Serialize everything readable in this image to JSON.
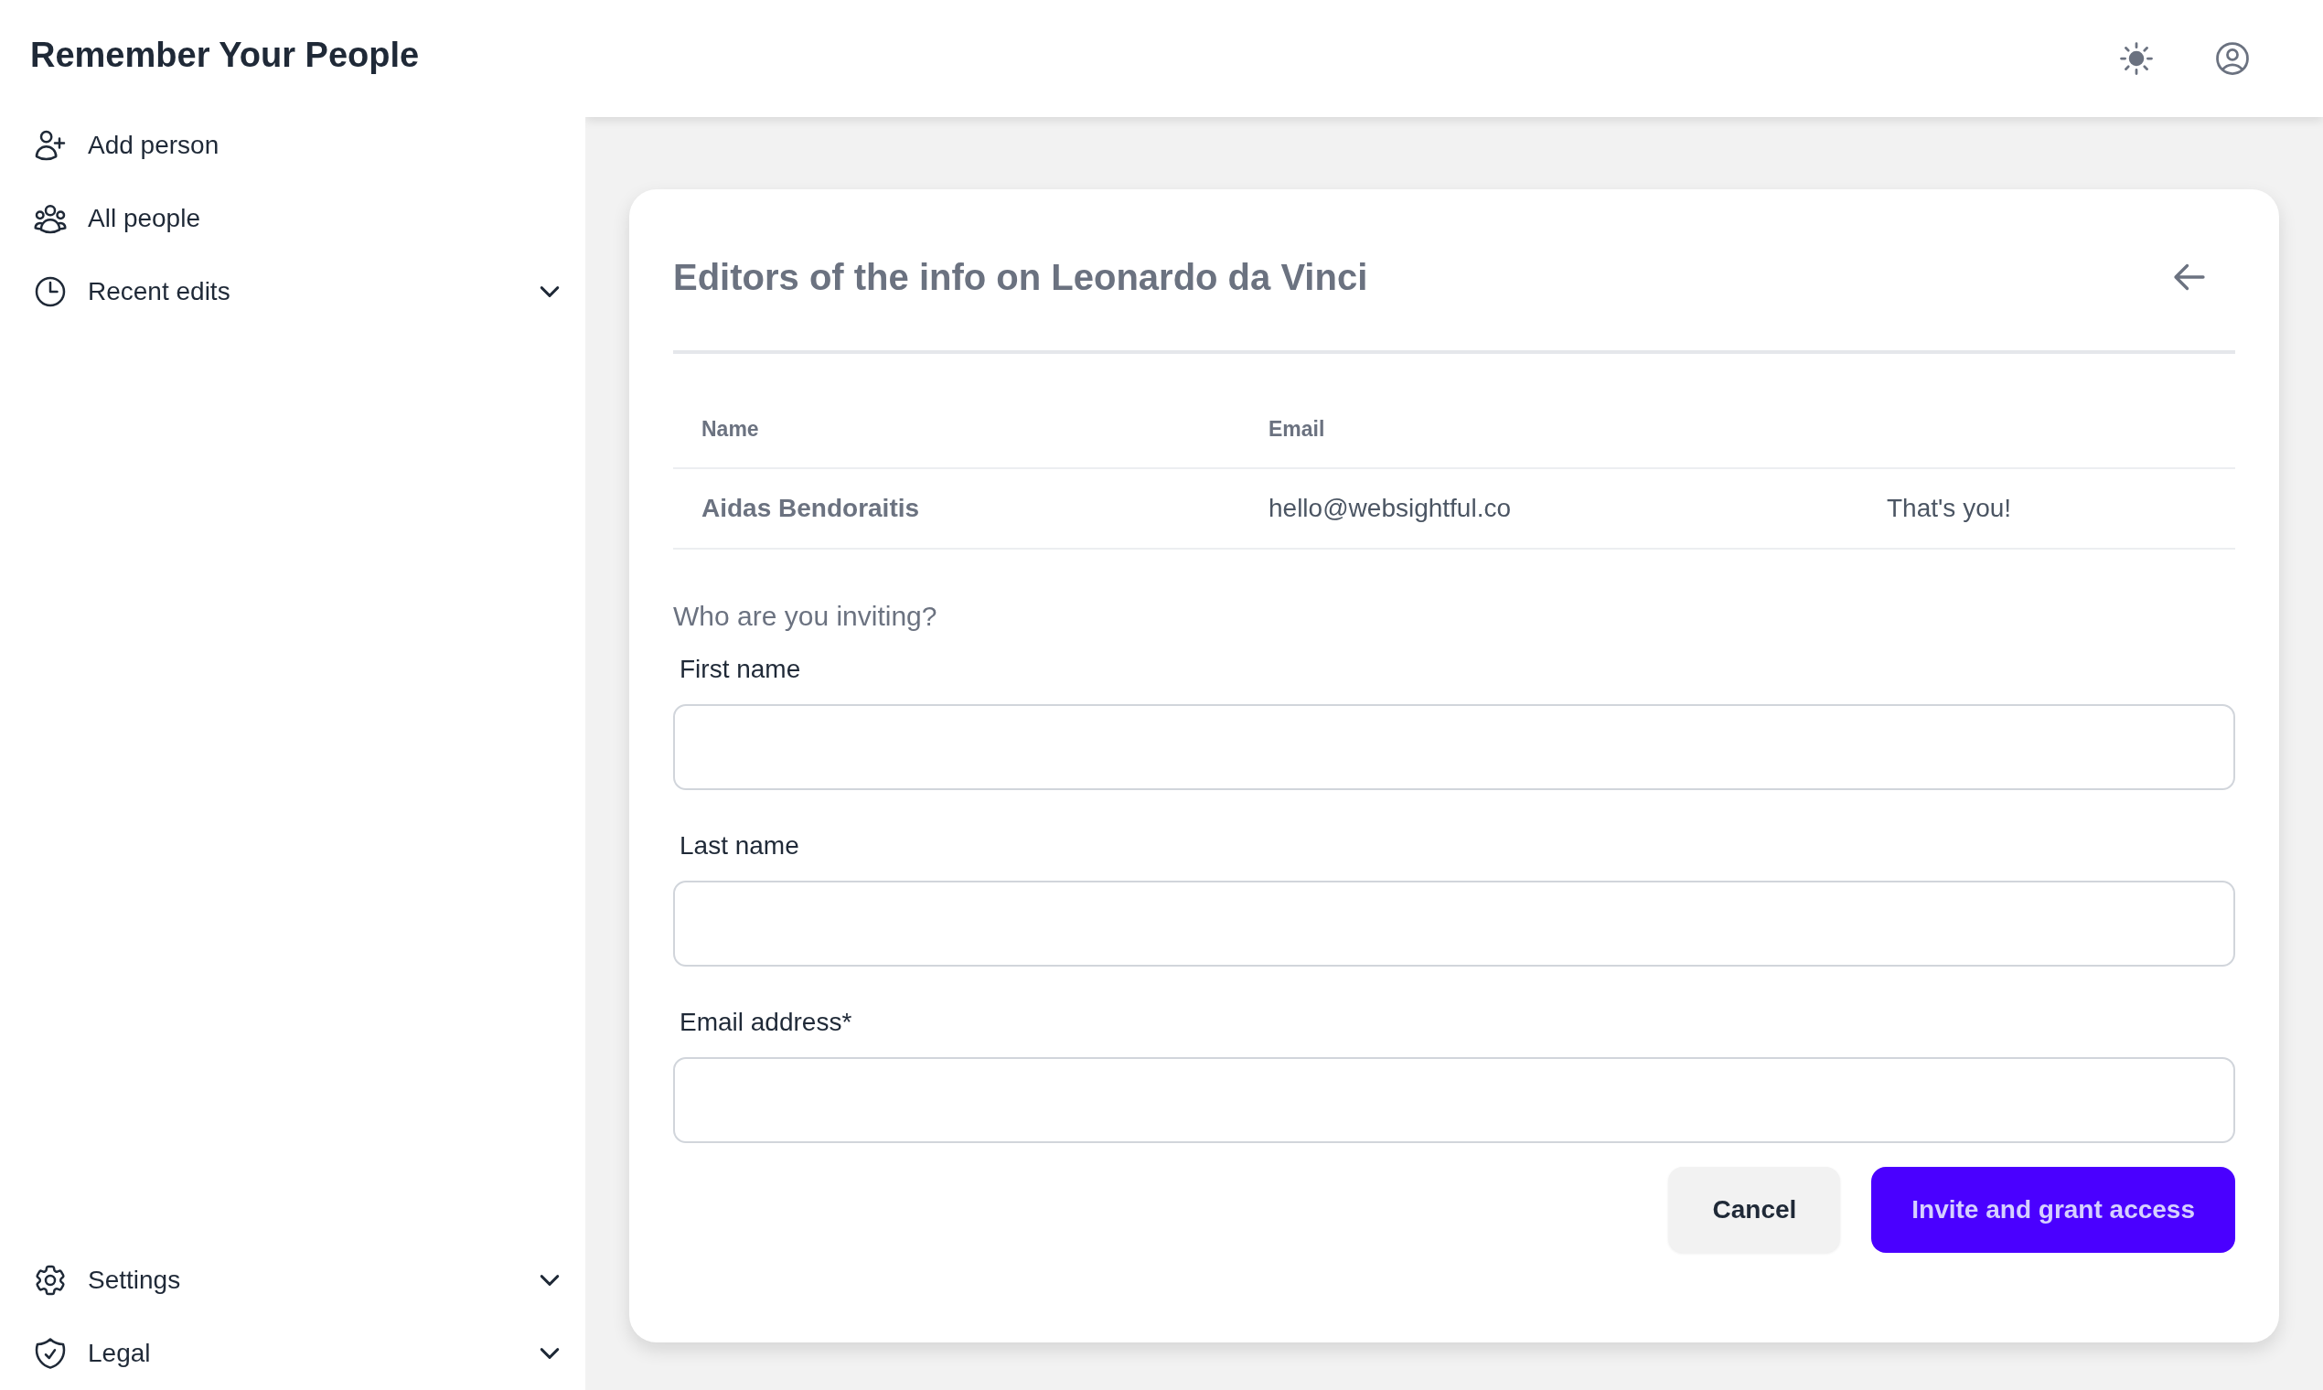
{
  "sidebar": {
    "title": "Remember Your People",
    "nav_items": [
      {
        "label": "Add person",
        "kind": "link"
      },
      {
        "label": "All people",
        "kind": "link"
      },
      {
        "label": "Recent edits",
        "kind": "group",
        "expanded": false
      }
    ],
    "bottom_items": [
      {
        "label": "Settings",
        "kind": "group",
        "expanded": false
      },
      {
        "label": "Legal",
        "kind": "group",
        "expanded": false
      }
    ]
  },
  "card": {
    "title": "Editors of the info on Leonardo da Vinci",
    "table": {
      "columns": [
        "Name",
        "Email"
      ],
      "rows": [
        {
          "cells": [
            "Aidas Bendoraitis",
            "hello@websightful.co",
            "That's you!"
          ]
        }
      ]
    },
    "invite_form": {
      "prompt": "Who are you inviting?",
      "fields": [
        {
          "label": "First name"
        },
        {
          "label": "Last name"
        },
        {
          "label": "Email address*"
        }
      ],
      "buttons": [
        {
          "label": "Cancel",
          "kind": "secondary"
        },
        {
          "label": "Invite and grant access",
          "kind": "primary"
        }
      ]
    }
  }
}
